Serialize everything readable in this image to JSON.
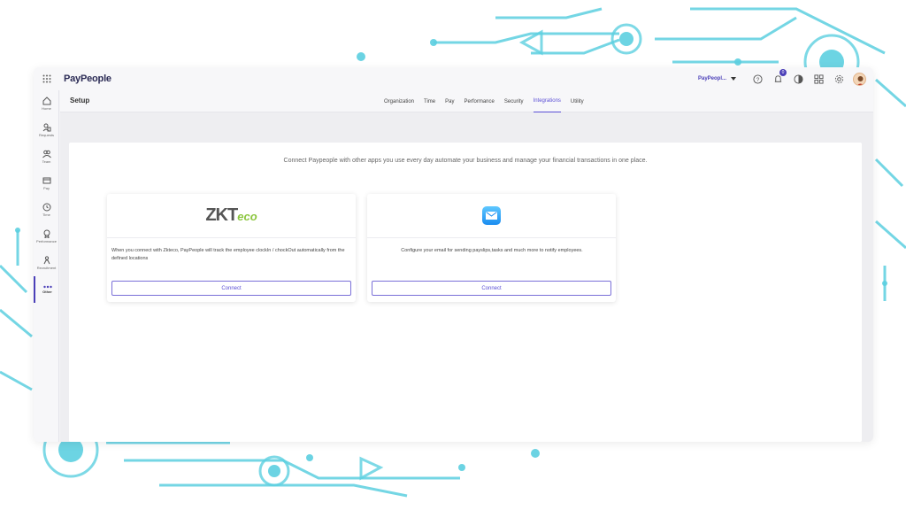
{
  "app": {
    "logo": "PayPeople",
    "company": "PayPeopl...",
    "notification_count": "0"
  },
  "sidebar": {
    "items": [
      {
        "label": "Home",
        "icon": "home-icon"
      },
      {
        "label": "Requests",
        "icon": "requests-icon"
      },
      {
        "label": "Team",
        "icon": "team-icon"
      },
      {
        "label": "Pay",
        "icon": "pay-icon"
      },
      {
        "label": "Time",
        "icon": "clock-icon"
      },
      {
        "label": "Performance",
        "icon": "performance-icon"
      },
      {
        "label": "Recruitment",
        "icon": "recruitment-icon"
      },
      {
        "label": "Other",
        "icon": "more-icon"
      }
    ]
  },
  "setup": {
    "title": "Setup",
    "tabs": [
      "Organization",
      "Time",
      "Pay",
      "Performance",
      "Security",
      "Integrations",
      "Utility"
    ],
    "active_tab": "Integrations"
  },
  "integrations": {
    "intro": "Connect Paypeople with other apps you use every day automate your business and manage your financial transactions in one place.",
    "cards": [
      {
        "logo_text": "ZKT",
        "logo_suffix": "eco",
        "description": "When you connect with Zkteco, PayPeople will track the employee clockIn / chockOut automatically from the defined locations",
        "button": "Connect"
      },
      {
        "logo_icon": "mail-icon",
        "description": "Configure your email for sending payslips,tasks and much more to notify employees.",
        "button": "Connect"
      }
    ]
  },
  "colors": {
    "accent": "#5b4fd6",
    "decor": "#5ccfe0"
  }
}
